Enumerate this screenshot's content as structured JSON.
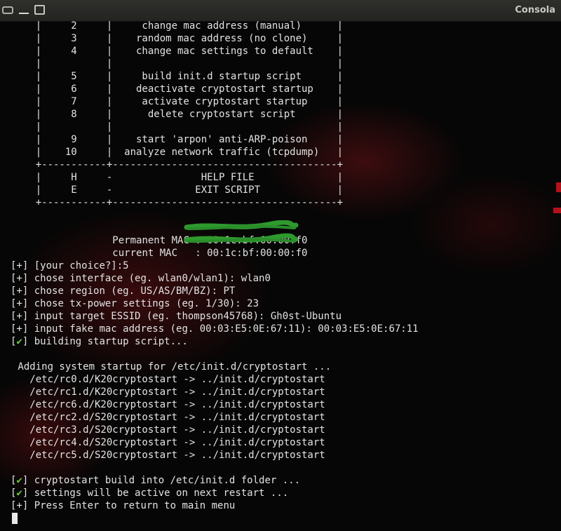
{
  "window": {
    "title": "Consola"
  },
  "colors": {
    "background": "#070606",
    "text": "#e3e3e3",
    "check": "#6bd12f",
    "redaction": "#2e9a2e",
    "accent_red": "#b2121c"
  },
  "menu": {
    "rows": [
      "    |     2     |     change mac address (manual)      |",
      "    |     3     |    random mac address (no clone)     |",
      "    |     4     |    change mac settings to default    |",
      "    |           |                                      |",
      "    |     5     |     build init.d startup script      |",
      "    |     6     |    deactivate cryptostart startup    |",
      "    |     7     |     activate cryptostart startup     |",
      "    |     8     |      delete cryptostart script       |",
      "    |           |                                      |",
      "    |     9     |    start 'arpon' anti-ARP-poison     |",
      "    |    10     |  analyze network traffic (tcpdump)   |",
      "    +-----------+--------------------------------------+",
      "    |     H     -               HELP FILE              |",
      "    |     E     -              EXIT SCRIPT             |",
      "    +-----------+--------------------------------------+"
    ]
  },
  "mac_info": {
    "permanent_label": "           Permanent MAC : ",
    "permanent_value": "00:1c:bf:00:00:f0",
    "current_label": "           current MAC   : ",
    "current_value": "00:1c:bf:00:00:f0"
  },
  "session": {
    "choice_prefix": "[+]",
    "choice": " [your choice?]:5",
    "interface_prefix": "[+]",
    "interface": " chose interface (eg. wlan0/wlan1): wlan0",
    "region_prefix": "[+]",
    "region": " chose region (eg. US/AS/BM/BZ): PT",
    "txpower_prefix": "[+]",
    "txpower": " chose tx-power settings (eg. 1/30): 23",
    "essid_prefix": "[+]",
    "essid": " input target ESSID (eg. thompson45768): Gh0st-Ubuntu",
    "fakemac_prefix": "[+]",
    "fakemac": " input fake mac address (eg. 00:03:E5:0E:67:11): 00:03:E5:0E:67:11",
    "building_open": "[",
    "building_check": "✔",
    "building_close": "]",
    "building": " building startup script..."
  },
  "startup_output": {
    "header": " Adding system startup for /etc/init.d/cryptostart ...",
    "links": [
      "   /etc/rc0.d/K20cryptostart -> ../init.d/cryptostart",
      "   /etc/rc1.d/K20cryptostart -> ../init.d/cryptostart",
      "   /etc/rc6.d/K20cryptostart -> ../init.d/cryptostart",
      "   /etc/rc2.d/S20cryptostart -> ../init.d/cryptostart",
      "   /etc/rc3.d/S20cryptostart -> ../init.d/cryptostart",
      "   /etc/rc4.d/S20cryptostart -> ../init.d/cryptostart",
      "   /etc/rc5.d/S20cryptostart -> ../init.d/cryptostart"
    ]
  },
  "result": {
    "built_open": "[",
    "built_check": "✔",
    "built_close": "]",
    "built": " cryptostart build into /etc/init.d folder ...",
    "active_open": "[",
    "active_check": "✔",
    "active_close": "]",
    "active": " settings will be active on next restart ...",
    "enter_prefix": "[+]",
    "enter": " Press Enter to return to main menu"
  }
}
